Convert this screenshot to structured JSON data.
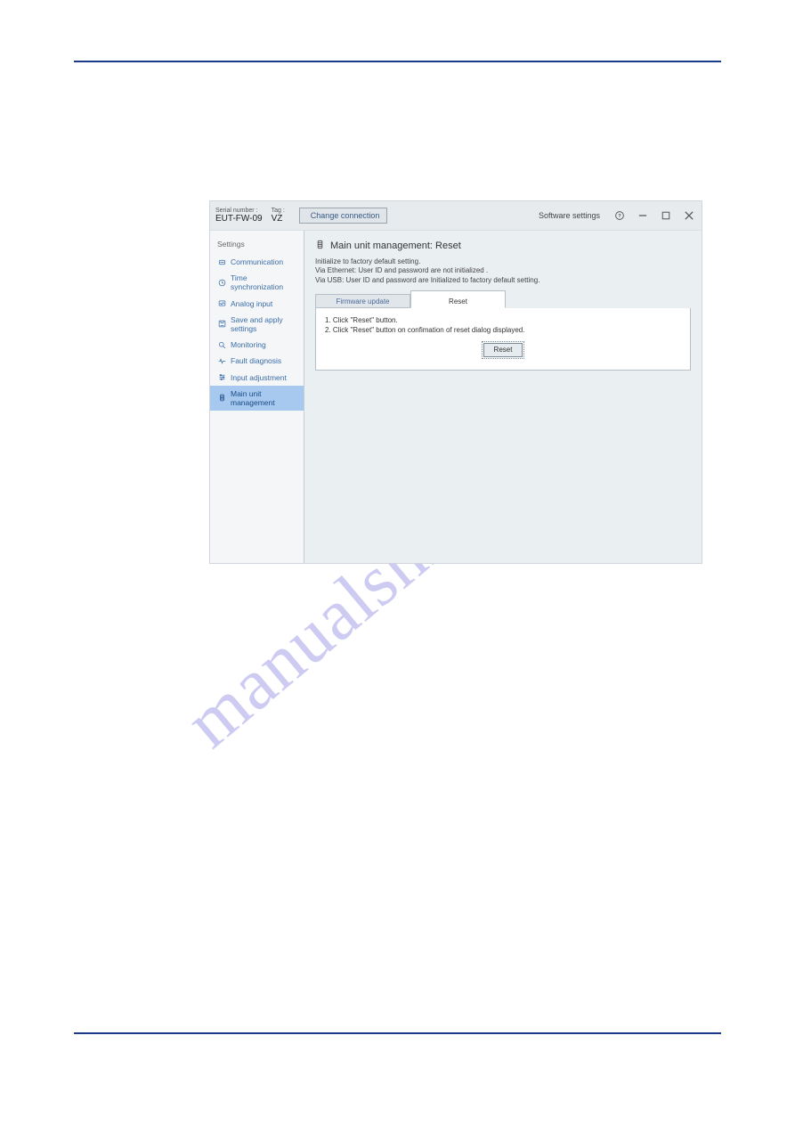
{
  "watermark": "manualshive.com",
  "titlebar": {
    "serial_label": "Serial number :",
    "serial_value": "EUT-FW-09",
    "tag_label": "Tag :",
    "tag_value": "VZ",
    "change_connection": "Change connection",
    "software_settings": "Software settings"
  },
  "sidebar": {
    "header": "Settings",
    "items": [
      {
        "id": "communication",
        "label": "Communication"
      },
      {
        "id": "time-sync",
        "label": "Time synchronization"
      },
      {
        "id": "analog-input",
        "label": "Analog input"
      },
      {
        "id": "save-apply",
        "label": "Save and apply settings"
      },
      {
        "id": "monitoring",
        "label": "Monitoring"
      },
      {
        "id": "fault-diag",
        "label": "Fault diagnosis"
      },
      {
        "id": "input-adjust",
        "label": "Input adjustment"
      },
      {
        "id": "main-unit-mgmt",
        "label": "Main unit management"
      }
    ]
  },
  "content": {
    "title": "Main unit management:  Reset",
    "desc_line1": "Initialize to factory default setting.",
    "desc_line2": "Via Ethernet: User ID and password are not initialized .",
    "desc_line3": "Via USB: User ID and password are Initialized to factory default setting.",
    "tabs": {
      "firmware": "Firmware update",
      "reset": "Reset"
    },
    "steps": {
      "s1": "1. Click \"Reset\" button.",
      "s2": "2. Click \"Reset\" button on confimation of reset dialog displayed."
    },
    "reset_btn": "Reset"
  }
}
